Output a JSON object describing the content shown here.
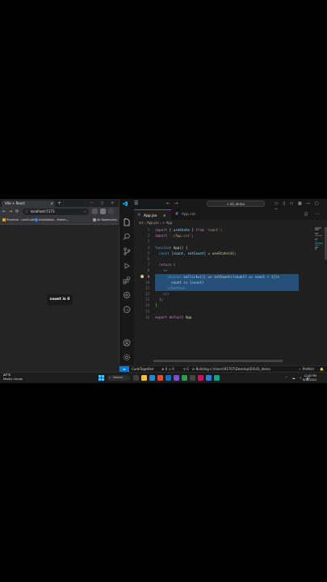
{
  "browser": {
    "tab_title": "Vite + React",
    "tab_close": "×",
    "new_tab": "+",
    "window_controls": "—  ▢  ✕",
    "nav_back": "←",
    "nav_forward": "→",
    "nav_reload": "⟳",
    "url": "localhost:5173",
    "bookmarks": [
      "Proxlene - LeetCode",
      "Installation - Moten...",
      "All Bookmarks"
    ],
    "count_button_label": "count is 0"
  },
  "vscode": {
    "search_text": "⌕ d3_demo",
    "menu": "☰",
    "tabs": [
      {
        "label": "App.jsx",
        "active": true
      },
      {
        "label": "App.css",
        "active": false
      }
    ],
    "tab_close": "×",
    "tab_actions": "◫ ⋯",
    "breadcrumb": "src  ›  App.jsx  ›  ⚛ App",
    "line_numbers": [
      "1",
      "2",
      "3",
      "4",
      "5",
      "6",
      "7",
      "8",
      "9",
      "10",
      "11",
      "12",
      "13",
      "14",
      "15",
      "16"
    ],
    "code": {
      "l1": {
        "a": "import",
        "b": " { ",
        "c": "useState",
        "d": " } ",
        "e": "from",
        "f": " 'react'",
        "g": ";"
      },
      "l2": {
        "a": "import",
        "b": " './App.css'",
        "c": ";"
      },
      "l4": {
        "a": "function",
        "b": " App",
        "c": "() {"
      },
      "l5": {
        "a": "  const",
        "b": " [count, setCount]",
        "c": " = ",
        "d": "useState",
        "e": "(",
        "f": "0",
        "g": ");"
      },
      "l7": {
        "a": "  return",
        "b": " ("
      },
      "l8": {
        "a": "    <>"
      },
      "l9": {
        "a": "      <",
        "b": "button",
        "c": " onClick",
        "d": "={() => ",
        "e": "setCount",
        "f": "((count) => count + ",
        "g": "1",
        "h": ")}>"
      },
      "l10": {
        "a": "        count is ",
        "b": "{count}"
      },
      "l11": {
        "a": "      </",
        "b": "button",
        "c": ">"
      },
      "l12": {
        "a": "    </>"
      },
      "l13": {
        "a": "  );"
      },
      "l14": {
        "a": "}"
      },
      "l16": {
        "a": "export",
        "b": " default",
        "c": " App"
      }
    },
    "status": {
      "remote": "⇄",
      "codetogether": "CodeTogether",
      "problems": "⊗ 0  ⚠ 0",
      "ports": "⚲ 0",
      "building": "⟳ Building c:\\Users\\91707\\Desktop\\D3\\d3_demo",
      "prettier": "✓ Prettier",
      "bell": "🔔"
    }
  },
  "taskbar": {
    "temp": "27°C",
    "weather": "Mostly cloudy",
    "search_label": "Search",
    "tray": "⌃ ☁ ⚡ 🔊",
    "time": "12:03 PM",
    "date": "6/10/2024"
  }
}
